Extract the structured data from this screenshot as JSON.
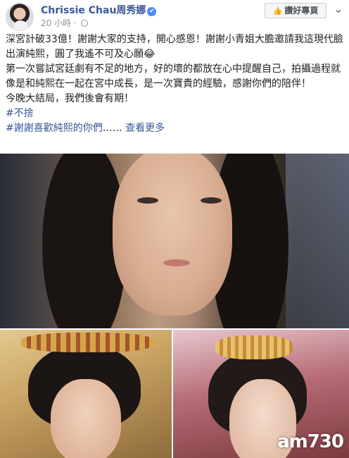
{
  "header": {
    "page_name": "Chrissie Chau周秀娜",
    "verified_mark": "✔",
    "time": "20 小時",
    "like_page_label": "讚好專頁",
    "more_glyph": "⌄"
  },
  "post": {
    "lines": [
      "深宮計破33億！謝謝大家的支持，開心感恩！謝謝小青姐大膽邀請我這現代臉出演純熙，圓了我遙不可及心願😂",
      "第一次嘗試宮廷劇有不足的地方，好的壞的都放在心中提醒自己，拍攝過程就像是和純熙在一起在宮中成長，是一次寶貴的經驗，感謝你們的陪伴！",
      "今晚大結局，我們後會有期！"
    ],
    "hashtag_1": "#不捨",
    "hashtag_2": "#謝謝喜歡純熙的你們",
    "ellipsis": "……",
    "see_more": "查看更多"
  },
  "photos": {
    "watermark": "am730"
  },
  "colors": {
    "link": "#385898",
    "text": "#1c1e21",
    "meta": "#90949c"
  }
}
